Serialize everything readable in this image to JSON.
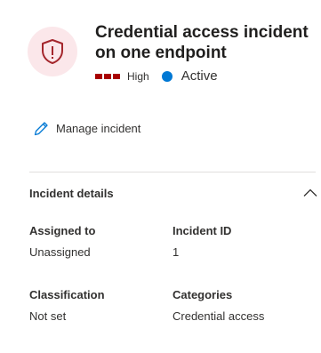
{
  "incident": {
    "title": "Credential access incident on one endpoint",
    "severity_label": "High",
    "status_label": "Active",
    "icon": "shield-alert-icon"
  },
  "colors": {
    "severity": "#a80000",
    "status": "#0078d4",
    "icon_bg": "#fbe7ea",
    "icon_fg": "#a4262c"
  },
  "actions": {
    "manage_label": "Manage incident",
    "manage_icon": "pencil-icon"
  },
  "details": {
    "section_title": "Incident details",
    "toggle_icon": "chevron-up-icon",
    "fields": [
      {
        "label": "Assigned to",
        "value": "Unassigned"
      },
      {
        "label": "Incident ID",
        "value": "1"
      },
      {
        "label": "Classification",
        "value": "Not set"
      },
      {
        "label": "Categories",
        "value": "Credential access"
      }
    ]
  }
}
